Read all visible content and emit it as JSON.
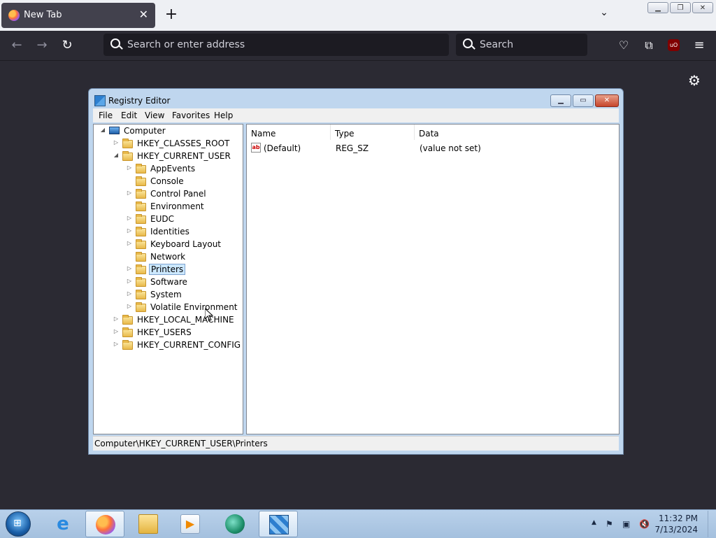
{
  "browser": {
    "tab_title": "New Tab",
    "url_placeholder": "Search or enter address",
    "search_placeholder": "Search",
    "ublock_label": "uO"
  },
  "regedit": {
    "window_title": "Registry Editor",
    "menu": [
      "File",
      "Edit",
      "View",
      "Favorites",
      "Help"
    ],
    "tree": {
      "root": "Computer",
      "hives": [
        "HKEY_CLASSES_ROOT",
        "HKEY_CURRENT_USER",
        "HKEY_LOCAL_MACHINE",
        "HKEY_USERS",
        "HKEY_CURRENT_CONFIG"
      ],
      "current_user_children": [
        "AppEvents",
        "Console",
        "Control Panel",
        "Environment",
        "EUDC",
        "Identities",
        "Keyboard Layout",
        "Network",
        "Printers",
        "Software",
        "System",
        "Volatile Environment"
      ],
      "selected": "Printers"
    },
    "columns": [
      "Name",
      "Type",
      "Data"
    ],
    "values": [
      {
        "name": "(Default)",
        "type": "REG_SZ",
        "data": "(value not set)"
      }
    ],
    "status_path": "Computer\\HKEY_CURRENT_USER\\Printers"
  },
  "taskbar": {
    "time": "11:32 PM",
    "date": "7/13/2024"
  }
}
